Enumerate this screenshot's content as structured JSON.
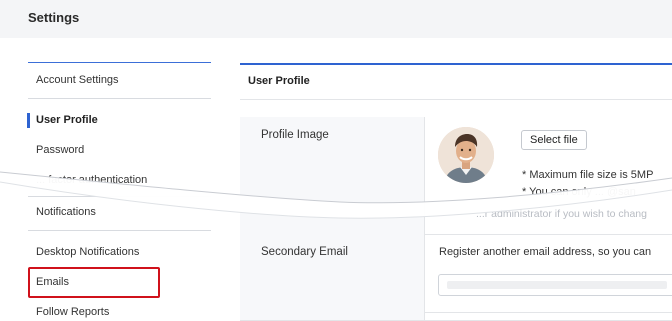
{
  "header": {
    "title": "Settings"
  },
  "sidebar": {
    "sections": [
      {
        "label": "Account Settings"
      },
      {
        "label": "Notifications"
      }
    ],
    "account_items": [
      {
        "label": "User Profile",
        "active": true
      },
      {
        "label": "Password"
      },
      {
        "label": "... factor authentication"
      }
    ],
    "notification_items": [
      {
        "label": "Desktop Notifications"
      },
      {
        "label": "Emails",
        "highlighted": true
      },
      {
        "label": "Follow Reports"
      }
    ]
  },
  "main": {
    "section_title": "User Profile",
    "profile_image": {
      "label": "Profile Image",
      "button_label": "Select file",
      "note_1": "* Maximum file size is 5MP",
      "note_2": "* You can only ... @san",
      "note_3": "...r administrator if you wish to chang"
    },
    "secondary_email": {
      "label": "Secondary Email",
      "description": "Register another email address, so you can",
      "input_value": ""
    }
  },
  "colors": {
    "accent": "#2e63d1",
    "highlight": "#d0111b",
    "header_bg": "#f4f5f7"
  }
}
